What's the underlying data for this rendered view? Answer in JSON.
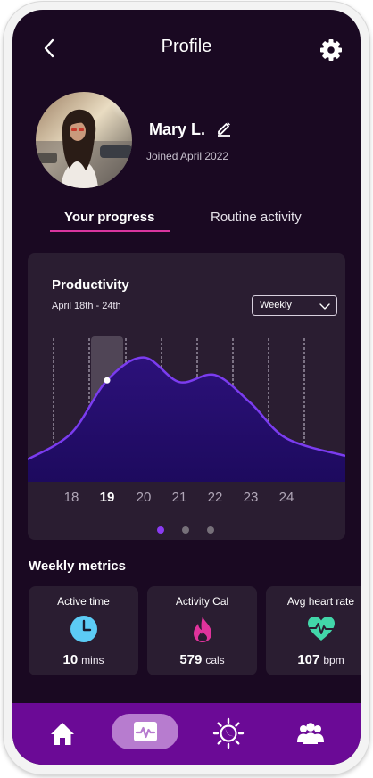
{
  "header": {
    "title": "Profile",
    "back_icon": "back-arrow-icon",
    "settings_icon": "gear-icon"
  },
  "profile": {
    "name": "Mary L.",
    "joined": "Joined April 2022",
    "edit_icon": "pencil-icon"
  },
  "tabs": [
    {
      "label": "Your progress",
      "active": true
    },
    {
      "label": "Routine activity",
      "active": false
    }
  ],
  "productivity": {
    "title": "Productivity",
    "date_range": "April 18th - 24th",
    "period": "Weekly",
    "selected_day": "19",
    "days": [
      "18",
      "19",
      "20",
      "21",
      "22",
      "23",
      "24"
    ],
    "pager": {
      "count": 3,
      "active": 0
    }
  },
  "chart_data": {
    "type": "area",
    "x": [
      "18",
      "19",
      "20",
      "21",
      "22",
      "23",
      "24"
    ],
    "series": [
      {
        "values": [
          45,
          75,
          88,
          74,
          78,
          62,
          42
        ]
      }
    ],
    "ylim": [
      0,
      100
    ],
    "grid": "vertical-dashed",
    "colors": {
      "line": "#7b3cf0",
      "fill_top": "#2c117a",
      "fill_bottom": "#1d0a5e"
    }
  },
  "metrics": {
    "title": "Weekly metrics",
    "items": [
      {
        "label": "Active time",
        "value": "10",
        "unit": "mins",
        "icon": "clock-icon",
        "color": "#5ccbf5"
      },
      {
        "label": "Activity Cal",
        "value": "579",
        "unit": "cals",
        "icon": "flame-icon",
        "color": "#e0339c"
      },
      {
        "label": "Avg heart rate",
        "value": "107",
        "unit": "bpm",
        "icon": "heart-pulse-icon",
        "color": "#42d6a9"
      }
    ]
  },
  "nav": [
    {
      "icon": "home-icon",
      "active": false
    },
    {
      "icon": "activity-icon",
      "active": true
    },
    {
      "icon": "sun-moon-icon",
      "active": false
    },
    {
      "icon": "community-icon",
      "active": false
    }
  ],
  "colors": {
    "background": "#1a0922",
    "card": "#2a1d31",
    "accent": "#d9359f",
    "nav": "#6b0a96"
  }
}
